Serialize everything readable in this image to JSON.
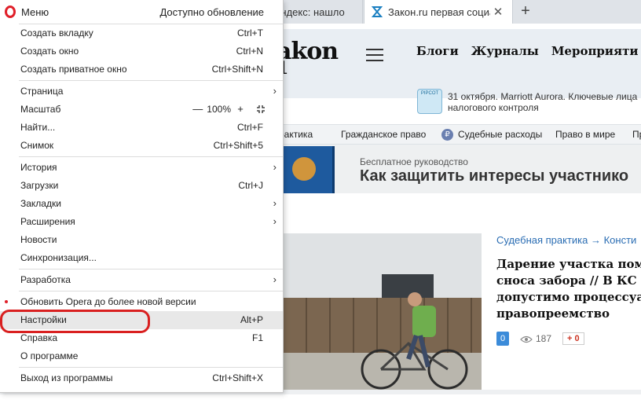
{
  "tabs": [
    {
      "title": "Яндекс: нашло",
      "active": false
    },
    {
      "title": "Закон.ru первая социальн",
      "active": true
    }
  ],
  "newtab_symbol": "+",
  "close_symbol": "✕",
  "site": {
    "logo_main": "akon",
    "logo_sub": "1",
    "nav": [
      "Блоги",
      "Журналы",
      "Мероприяти"
    ],
    "event_badge": "PIPCOT",
    "event_text": "31 октября. Marriott Aurora. Ключевые лица налогового контроля",
    "subnav": [
      "рактика",
      "Гражданское право",
      "Судебные расходы",
      "Право в мире",
      "Пр"
    ],
    "rub_symbol": "₽",
    "banner_small": "Бесплатное руководство",
    "banner_big": "Как защитить интересы участнико",
    "article": {
      "category": "Судебная практика → Консти",
      "title_lines": [
        "Дарение участка пом",
        "сноса забора // В КС с",
        "допустимо процессуа",
        "правопреемство"
      ],
      "comments": "0",
      "views": "187",
      "plus": "+ 0"
    }
  },
  "menu": {
    "title": "Меню",
    "update_link": "Доступно обновление",
    "zoom_minus": "—",
    "zoom_value": "100%",
    "zoom_plus": "+",
    "arrow": "›",
    "items": {
      "new_tab": {
        "label": "Создать вкладку",
        "shortcut": "Ctrl+T"
      },
      "new_window": {
        "label": "Создать окно",
        "shortcut": "Ctrl+N"
      },
      "new_private": {
        "label": "Создать приватное окно",
        "shortcut": "Ctrl+Shift+N"
      },
      "page": {
        "label": "Страница"
      },
      "zoom": {
        "label": "Масштаб"
      },
      "find": {
        "label": "Найти...",
        "shortcut": "Ctrl+F"
      },
      "snapshot": {
        "label": "Снимок",
        "shortcut": "Ctrl+Shift+5"
      },
      "history": {
        "label": "История"
      },
      "downloads": {
        "label": "Загрузки",
        "shortcut": "Ctrl+J"
      },
      "bookmarks": {
        "label": "Закладки"
      },
      "extensions": {
        "label": "Расширения"
      },
      "news": {
        "label": "Новости"
      },
      "sync": {
        "label": "Синхронизация..."
      },
      "developer": {
        "label": "Разработка"
      },
      "update": {
        "label": "Обновить Opera до более новой версии"
      },
      "settings": {
        "label": "Настройки",
        "shortcut": "Alt+P"
      },
      "help": {
        "label": "Справка",
        "shortcut": "F1"
      },
      "about": {
        "label": "О программе"
      },
      "exit": {
        "label": "Выход из программы",
        "shortcut": "Ctrl+Shift+X"
      }
    }
  },
  "colors": {
    "opera_red": "#e0202a",
    "highlight_ring": "#d92020",
    "link_blue": "#2a6db3"
  }
}
